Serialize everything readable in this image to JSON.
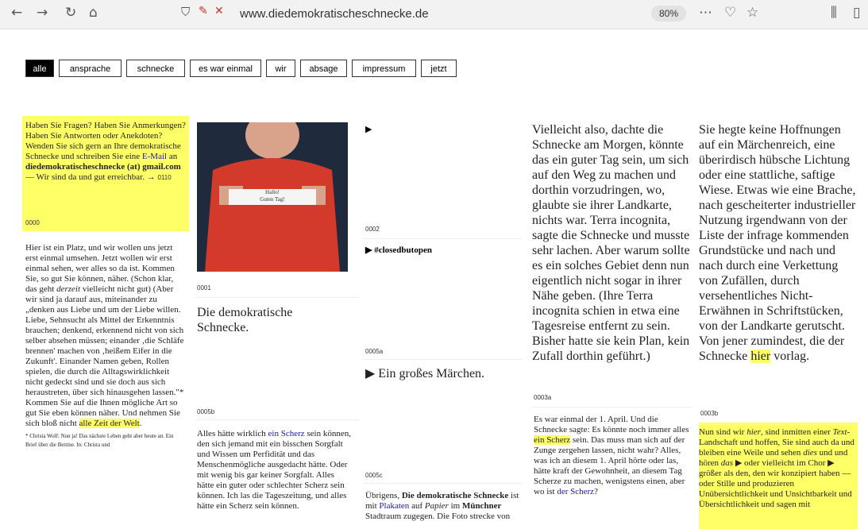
{
  "browser": {
    "url": "www.diedemokratischeschnecke.de",
    "zoom": "80%",
    "icons": [
      "back-icon",
      "forward-icon",
      "reload-icon",
      "home-icon",
      "shield-icon",
      "camera-off-icon",
      "mic-off-icon",
      "menu-dots-icon",
      "pocket-icon",
      "bookmark-star-icon",
      "library-icon",
      "sidebar-icon"
    ]
  },
  "menu": {
    "items": [
      "alle",
      "ansprache",
      "schnecke",
      "es war einmal",
      "wir",
      "absage",
      "impressum",
      "jetzt"
    ]
  },
  "col1": {
    "contact": {
      "text1": "Haben Sie Fragen? Haben Sie Anmerkungen? Haben Sie Antworten oder Anekdoten? Wenden Sie sich gern an Ihre demokratische Schnecke und schreiben Sie eine ",
      "link": "E-Mail",
      "text2": " an ",
      "email": "diedemokratischeschnecke (at) gmail.com",
      "text3": " — Wir sind da und gut erreichbar. → ",
      "ref": "0110",
      "id": "0000"
    },
    "intro": {
      "text1": "Hier ist ein Platz, und wir wollen uns jetzt erst einmal umsehen. Jetzt wollen wir erst einmal sehen, wer alles so da ist. Kommen Sie, so gut Sie können, näher. (Schon klar, das geht ",
      "em": "derzeit",
      "text2": " vielleicht nicht gut) (Aber wir sind ja darauf aus, miteinander zu „denken aus Liebe und um der Liebe willen. Liebe, Sehnsucht als Mittel der Erkenntnis brauchen; denkend, erkennend nicht von sich selber absehen müssen; einander ‚die Schläfe brennen' machen von ‚heißem Eifer in die Zukunft'. Einander Namen geben, Rollen spielen, die durch die Alltagswirklichkeit nicht gedeckt sind und sie doch aus sich heraustreten, über sich hinausgehen lassen.\"* Kommen Sie auf die Ihnen mögliche Art so gut Sie eben können näher. Und nehmen Sie sich bloß nicht ",
      "hl": "alle Zeit der Welt",
      "text3": ".",
      "footnote": "* Christa Wolf: Nun ja! Das nächste Leben geht aber heute an. Ein Brief über die Bettine. In: Christa und"
    }
  },
  "col2": {
    "photo_sign": [
      "Hallo!",
      "Guten Tag!"
    ],
    "id1": "0001",
    "title": "Die demokratische Schnecke.",
    "id2": "0005b",
    "scherz": {
      "text1": "Alles hätte wirklich ",
      "link": "ein Scherz",
      "text2": " sein können, den sich jemand mit ein bisschen Sorgfalt und Wissen um Perfidität und das Menschenmögliche ausgedacht hätte. Oder mit wenig bis gar keiner Sorgfalt. Alles hätte ein guter oder schlechter Scherz sein können. Ich las die Tageszeitung, und alles hätte ein Scherz sein können."
    }
  },
  "col3": {
    "arrow1": "▶",
    "id1": "0002",
    "closed": "▶ #closedbutopen",
    "id2": "0005a",
    "maerchen": "▶ Ein großes Märchen.",
    "id3": "0005c",
    "plakat": {
      "text1": "Übrigens, ",
      "bold1": "Die demokratische Schnecke",
      "text2": " ist mit ",
      "link": "Plakaten",
      "text3": " auf ",
      "em": "Papier",
      "text4": " im ",
      "bold2": "Münchner",
      "text5": " Stadtraum zugegen.",
      "text6": "Die Foto strecke von "
    }
  },
  "col4": {
    "story": "Vielleicht also, dachte die Schnecke am Morgen, könnte das ein guter Tag sein, um sich auf den Weg zu machen und dorthin vorzudringen, wo, glaubte sie ihrer Landkarte, nichts war. Terra incognita, sagte die Schnecke und musste sehr lachen. Aber warum sollte es ein solches Gebiet denn nun eigentlich nicht sogar in ihrer Nähe geben. (Ihre Terra incognita schien in etwa eine Tagesreise entfernt zu sein. Bisher hatte sie kein Plan, kein Zufall dorthin geführt.)",
    "id": "0003a",
    "april": {
      "text1": "Es war einmal der 1. April. Und die Schnecke sagte: Es könnte noch immer alles ",
      "hl": "ein Scherz",
      "text2": " sein. Das muss man sich auf der Zunge zergehen lassen, nicht wahr? Alles, was ich an diesem 1. April hörte oder las, hätte kraft der Gewohnheit, an diesem Tag Scherze zu machen, wenigstens einen, aber wo ist ",
      "link": "der Scherz",
      "text3": "?"
    }
  },
  "col5": {
    "story1": "Sie hegte keine Hoffnungen auf ein Märchenreich, eine überirdisch hübsche Lichtung oder eine stattliche, saftige Wiese. Etwas wie eine Brache, nach gescheiterter industrieller Nutzung irgendwann von der Liste der infrage kommenden Grundstücke und nach und nach durch eine Verkettung von Zufällen, durch versehentliches Nicht-Erwähnen in Schriftstücken, von der Landkarte gerutscht. Von jener zumindest, die der Schnecke ",
    "hl": "hier",
    "story2": " vorlag.",
    "id": "0003b",
    "textland": {
      "text1": "Nun sind wir ",
      "em1": "hier",
      "text2": ", sind inmitten einer ",
      "em2": "Text",
      "text3": "-Landschaft und hoffen, Sie sind auch da und bleiben eine Weile und sehen ",
      "em3": "dies",
      "text4": " und und hören ",
      "em4": "das",
      "text5": " ▶ oder vielleicht im Chor ▶ größer als den, den wir konzipiert haben — oder Stille und produzieren Unübersichtlichkeit und Unsichtbarkeit und Übersichtlichkeit und sagen mit"
    }
  },
  "colors": {
    "highlight": "#ffff66",
    "link": "#1a1aa6",
    "photo_bg": "#1f2a3c",
    "shirt": "#d33a2c"
  }
}
